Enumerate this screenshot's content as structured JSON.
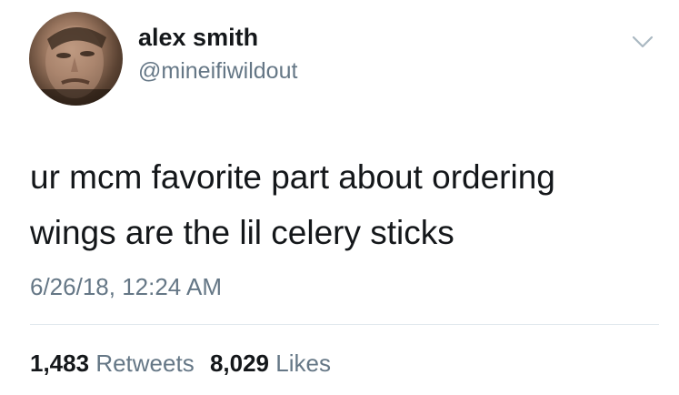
{
  "author": {
    "display_name": "alex smith",
    "handle": "@mineifiwildout",
    "avatar_icon": "user-avatar-photo"
  },
  "tweet": {
    "text_lines": [
      "ur mcm favorite part about ordering",
      "wings are the lil celery sticks"
    ],
    "timestamp": "6/26/18, 12:24 AM"
  },
  "stats": {
    "retweets_count": "1,483",
    "retweets_label": "Retweets",
    "likes_count": "8,029",
    "likes_label": "Likes"
  },
  "menu": {
    "icon": "chevron-down-icon"
  },
  "colors": {
    "primary_text": "#14171a",
    "secondary_text": "#657786",
    "divider": "#e1e8ed",
    "background": "#ffffff"
  }
}
